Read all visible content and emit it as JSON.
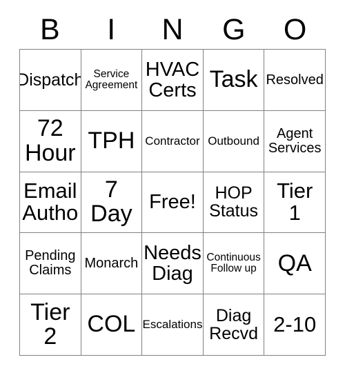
{
  "card": {
    "header_letters": [
      "B",
      "I",
      "N",
      "G",
      "O"
    ],
    "free_space_label": "Free!",
    "colors": {
      "background": "#ffffff",
      "text": "#000000",
      "border": "#808080"
    },
    "rows": [
      [
        {
          "label": "Dispatch",
          "size": "md"
        },
        {
          "label": "Service\nAgreement",
          "size": "xxs"
        },
        {
          "label": "HVAC\nCerts",
          "size": "lg"
        },
        {
          "label": "Task",
          "size": "xxl"
        },
        {
          "label": "Resolved",
          "size": "sm"
        }
      ],
      [
        {
          "label": "72\nHour",
          "size": "xxl"
        },
        {
          "label": "TPH",
          "size": "xxl"
        },
        {
          "label": "Contractor",
          "size": "xs"
        },
        {
          "label": "Outbound",
          "size": "xs"
        },
        {
          "label": "Agent\nServices",
          "size": "sm"
        }
      ],
      [
        {
          "label": "Email\nAutho",
          "size": "xl"
        },
        {
          "label": "7\nDay",
          "size": "xxl"
        },
        {
          "label": "Free!",
          "size": "lg"
        },
        {
          "label": "HOP\nStatus",
          "size": "md"
        },
        {
          "label": "Tier\n1",
          "size": "xl"
        }
      ],
      [
        {
          "label": "Pending\nClaims",
          "size": "sm"
        },
        {
          "label": "Monarch",
          "size": "sm"
        },
        {
          "label": "Needs\nDiag",
          "size": "lg"
        },
        {
          "label": "Continuous\nFollow up",
          "size": "xxs"
        },
        {
          "label": "QA",
          "size": "xxl"
        }
      ],
      [
        {
          "label": "Tier\n2",
          "size": "xxl"
        },
        {
          "label": "COL",
          "size": "xxl"
        },
        {
          "label": "Escalations",
          "size": "xs"
        },
        {
          "label": "Diag\nRecvd",
          "size": "md"
        },
        {
          "label": "2-10",
          "size": "xl"
        }
      ]
    ]
  }
}
